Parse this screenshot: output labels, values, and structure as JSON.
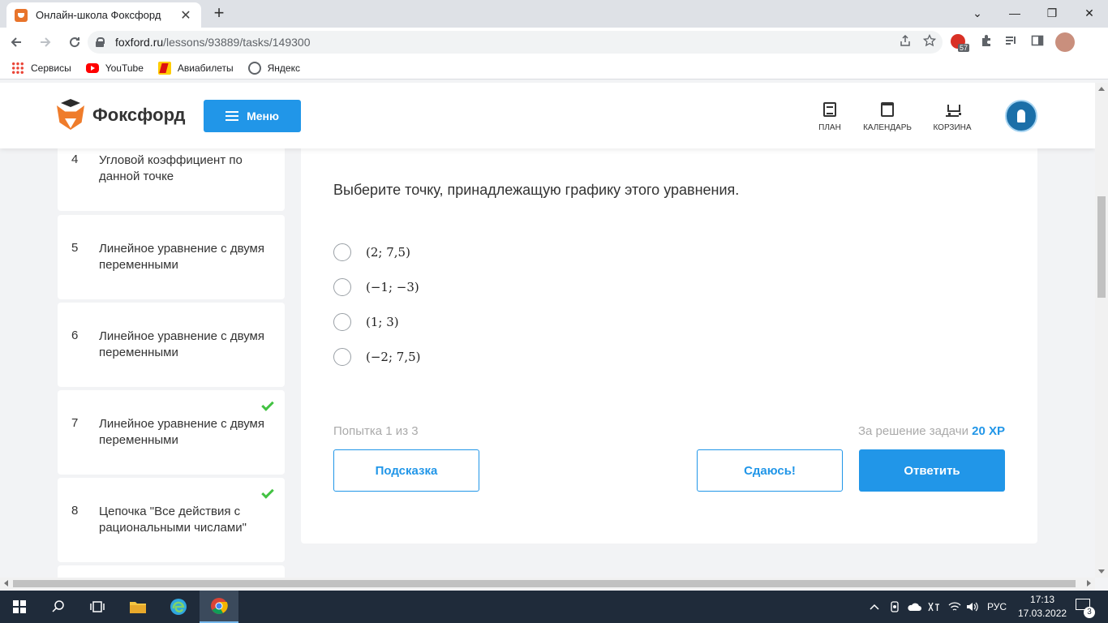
{
  "browser": {
    "tab_title": "Онлайн-школа Фоксфорд",
    "tab_close": "✕",
    "new_tab": "+",
    "url_host": "foxford.ru",
    "url_path": "/lessons/93889/tasks/149300",
    "extension_badge": "57",
    "window_buttons": [
      "⌄",
      "—",
      "❐",
      "✕"
    ]
  },
  "bookmarks": [
    {
      "label": "Сервисы",
      "icon": "apps-icon"
    },
    {
      "label": "YouTube",
      "icon": "youtube-icon"
    },
    {
      "label": "Авиабилеты",
      "icon": "avia-icon"
    },
    {
      "label": "Яндекс",
      "icon": "yandex-icon"
    }
  ],
  "header": {
    "logo_text": "Фоксфорд",
    "menu_label": "Меню",
    "nav": [
      {
        "label": "ПЛАН",
        "icon": "plan-icon"
      },
      {
        "label": "КАЛЕНДАРЬ",
        "icon": "calendar-icon"
      },
      {
        "label": "КОРЗИНА",
        "icon": "cart-icon"
      }
    ]
  },
  "sidebar": {
    "lessons": [
      {
        "num": "4",
        "title": "Угловой коэффициент по данной точке",
        "done": false
      },
      {
        "num": "5",
        "title": "Линейное уравнение с двумя переменными",
        "done": false
      },
      {
        "num": "6",
        "title": "Линейное уравнение с двумя переменными",
        "done": false
      },
      {
        "num": "7",
        "title": "Линейное уравнение с двумя переменными",
        "done": true
      },
      {
        "num": "8",
        "title": "Цепочка \"Все действия с рациональными числами\"",
        "done": true
      }
    ]
  },
  "task": {
    "question": "Выберите точку, принадлежащую графику этого уравнения.",
    "options": [
      "(2; 7,5)",
      "(−1; −3)",
      "(1; 3)",
      "(−2; 7,5)"
    ],
    "attempts": "Попытка 1 из 3",
    "reward_prefix": "За решение задачи",
    "reward_xp": "20 XP",
    "hint_label": "Подсказка",
    "giveup_label": "Сдаюсь!",
    "answer_label": "Ответить"
  },
  "taskbar": {
    "lang": "РУС",
    "time": "17:13",
    "date": "17.03.2022",
    "notifications": "3"
  },
  "colors": {
    "accent": "#2196e8",
    "check": "#43c243"
  }
}
